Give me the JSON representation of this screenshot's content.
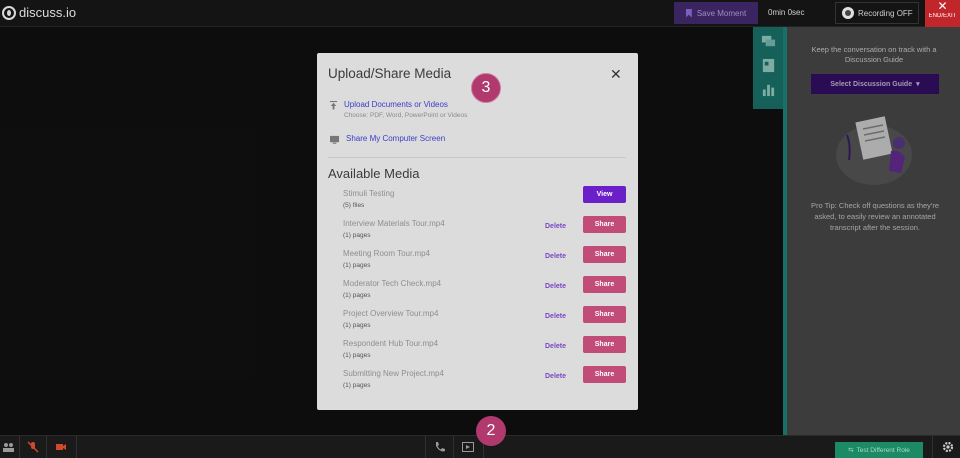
{
  "app": {
    "logo_text": "discuss.io"
  },
  "topbar": {
    "save_moment": "Save Moment",
    "timer": "0min 0sec",
    "recording": "Recording OFF",
    "end_label": "END/EXIT",
    "end_icon": "close-icon"
  },
  "side_panel": {
    "tabs": [
      "chat-icon",
      "guide-icon",
      "chart-icon"
    ],
    "title": "Keep the conversation on track with a Discussion Guide",
    "select_guide": "Select Discussion Guide",
    "pro_tip": "Pro Tip: Check off questions as they're asked, to easily review an annotated transcript after the session."
  },
  "modal": {
    "title": "Upload/Share Media",
    "upload_label": "Upload Documents or Videos",
    "upload_sub": "Choose: PDF, Word, PowerPoint or Videos",
    "share_screen_label": "Share My Computer Screen",
    "available_title": "Available Media",
    "delete_label": "Delete",
    "items": [
      {
        "name": "Stimuli Testing",
        "meta": "(5) files",
        "action": "View",
        "has_delete": false
      },
      {
        "name": "Interview Materials Tour.mp4",
        "meta": "(1) pages",
        "action": "Share",
        "has_delete": true
      },
      {
        "name": "Meeting Room Tour.mp4",
        "meta": "(1) pages",
        "action": "Share",
        "has_delete": true
      },
      {
        "name": "Moderator Tech Check.mp4",
        "meta": "(1) pages",
        "action": "Share",
        "has_delete": true
      },
      {
        "name": "Project Overview Tour.mp4",
        "meta": "(1) pages",
        "action": "Share",
        "has_delete": true
      },
      {
        "name": "Respondent Hub Tour.mp4",
        "meta": "(1) pages",
        "action": "Share",
        "has_delete": true
      },
      {
        "name": "Submitting New Project.mp4",
        "meta": "(1) pages",
        "action": "Share",
        "has_delete": true
      }
    ]
  },
  "badges": {
    "step3": "3",
    "step2": "2"
  },
  "bottombar": {
    "different_role": "Test Different Role"
  },
  "colors": {
    "accent_purple": "#6a1fc9",
    "share_pink": "#c24c78",
    "teal": "#1f8c80",
    "end_red": "#c0262a"
  }
}
